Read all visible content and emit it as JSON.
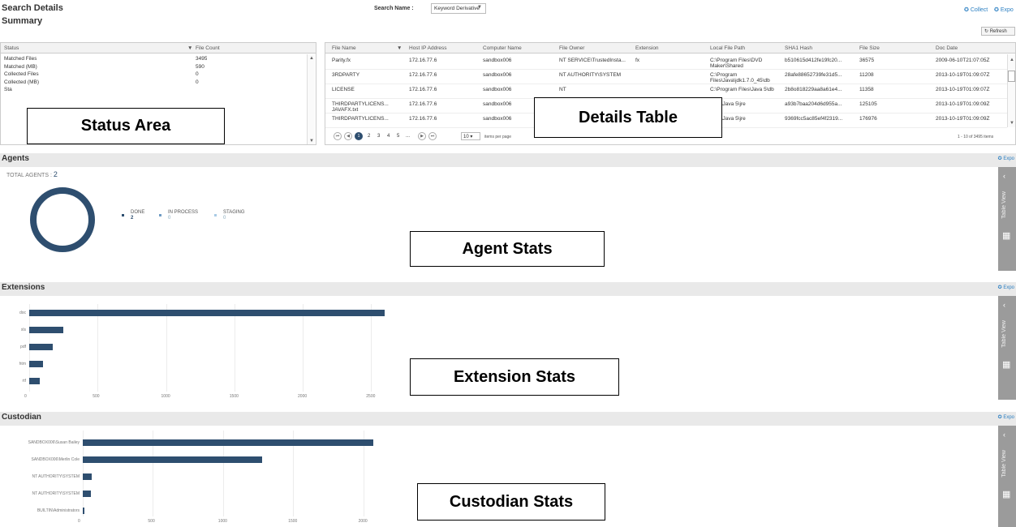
{
  "header": {
    "title": "Search Details",
    "subtitle": "Summary",
    "search_name_label": "Search Name :",
    "search_name_value": "Keyword Derivative",
    "collect_label": "Collect",
    "export_label": "Expo",
    "refresh_label": "Refresh"
  },
  "status_table": {
    "columns": [
      "Status",
      "File Count"
    ],
    "rows": [
      {
        "status": "Matched Files",
        "count": "3495"
      },
      {
        "status": "Matched (MB)",
        "count": "590"
      },
      {
        "status": "Collected Files",
        "count": "0"
      },
      {
        "status": "Collected (MB)",
        "count": "0"
      },
      {
        "status": "Sta",
        "count": ""
      }
    ]
  },
  "details_table": {
    "columns": [
      "File Name",
      "Host IP Address",
      "Computer Name",
      "File Owner",
      "Extension",
      "Local File Path",
      "SHA1 Hash",
      "File Size",
      "Doc Date"
    ],
    "rows": [
      {
        "name": "Parity.fx",
        "ip": "172.16.77.6",
        "computer": "sandbox006",
        "owner": "NT SERVICE\\TrustedInsta...",
        "ext": "fx",
        "path": "C:\\Program Files\\DVD Maker\\Shared",
        "sha": "b510615d412fe19fc20...",
        "size": "36575",
        "date": "2009-06-10T21:07:05Z"
      },
      {
        "name": "3RDPARTY",
        "ip": "172.16.77.6",
        "computer": "sandbox006",
        "owner": "NT AUTHORITY\\SYSTEM",
        "ext": "",
        "path": "C:\\Program Files\\Java\\jdk1.7.0_45\\db",
        "sha": "28afe88652739fe31d5...",
        "size": "11208",
        "date": "2013-10-19T01:09:07Z"
      },
      {
        "name": "LICENSE",
        "ip": "172.16.77.6",
        "computer": "sandbox006",
        "owner": "NT",
        "ext": "",
        "path": "C:\\Program Files\\Java 5\\db",
        "sha": "2b8o818229aa8a61e4...",
        "size": "11358",
        "date": "2013-10-19T01:09:07Z"
      },
      {
        "name": "THIRDPARTYLICENS... JAVAFX.txt",
        "ip": "172.16.77.6",
        "computer": "sandbox006",
        "owner": "",
        "ext": "",
        "path": "Files\\Java 5\\jre",
        "sha": "a93b7baa204d6d955a...",
        "size": "125105",
        "date": "2013-10-19T01:09:09Z"
      },
      {
        "name": "THIRDPARTYLICENS...",
        "ip": "172.16.77.6",
        "computer": "sandbox006",
        "owner": "",
        "ext": "",
        "path": "Files\\Java 5\\jre",
        "sha": "9369fcc5ac85ef4f2319...",
        "size": "176976",
        "date": "2013-10-19T01:09:09Z"
      }
    ],
    "pager": {
      "pages": [
        "1",
        "2",
        "3",
        "4",
        "5",
        "..."
      ],
      "page_size": "10",
      "page_size_label": "items per page",
      "range_label": "1 - 10 of 3495 items"
    }
  },
  "agents": {
    "title": "Agents",
    "export_label": "Expo",
    "total_label": "TOTAL AGENTS :",
    "total_value": "2",
    "legend": [
      {
        "label": "DONE",
        "value": "2",
        "color": "#2e4e6f"
      },
      {
        "label": "IN PROCESS",
        "value": "0",
        "color": "#6f9cc4"
      },
      {
        "label": "STAGING",
        "value": "0",
        "color": "#a9cbe6"
      }
    ]
  },
  "extensions": {
    "title": "Extensions",
    "export_label": "Expo"
  },
  "custodian": {
    "title": "Custodian",
    "export_label": "Expo"
  },
  "sidebar": {
    "table_view_label": "Table View"
  },
  "callouts": {
    "status_area": "Status Area",
    "details_table": "Details Table",
    "agent_stats": "Agent Stats",
    "extension_stats": "Extension Stats",
    "custodian_stats": "Custodian Stats"
  },
  "chart_data": [
    {
      "type": "bar",
      "orientation": "horizontal",
      "categories": [
        "doc",
        "xls",
        "pdf",
        "htm",
        "rtf"
      ],
      "values": [
        2600,
        250,
        170,
        100,
        80
      ],
      "xticks": [
        "0",
        "500",
        "1000",
        "1500",
        "2000",
        "2500"
      ],
      "xlim": [
        0,
        2700
      ]
    },
    {
      "type": "bar",
      "orientation": "horizontal",
      "categories": [
        "SANDBOX006\\Susan Bailey",
        "SANDBOX006\\Merlin Cole",
        "NT AUTHORITY\\SYSTEM",
        "NT AUTHORITY\\SYSTEM",
        "BUILTIN\\Administrators"
      ],
      "values": [
        2070,
        1280,
        65,
        55,
        12
      ],
      "xticks": [
        "0",
        "500",
        "1000",
        "1500",
        "2000"
      ],
      "xlim": [
        0,
        2500
      ]
    }
  ]
}
